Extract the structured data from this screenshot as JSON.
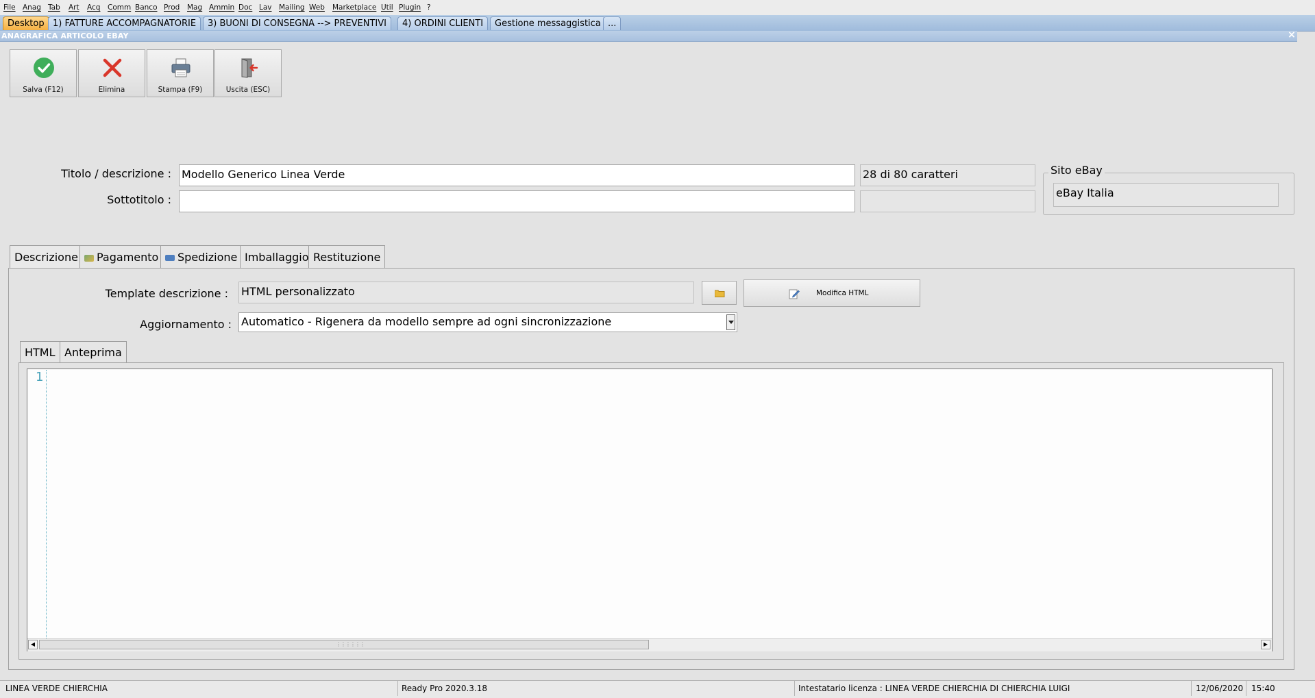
{
  "menu": [
    "File",
    "Anag",
    "Tab",
    "Art",
    "Acq",
    "Comm",
    "Banco",
    "Prod",
    "Mag",
    "Ammin",
    "Doc",
    "Lav",
    "Mailing",
    "Web",
    "Marketplace",
    "Util",
    "Plugin",
    "?"
  ],
  "doc_tabs": [
    "Desktop",
    "1) FATTURE ACCOMPAGNATORIE",
    "3) BUONI DI CONSEGNA --> PREVENTIVI",
    "4) ORDINI CLIENTI",
    "Gestione messaggistica",
    "..."
  ],
  "window": {
    "title": "ANAGRAFICA ARTICOLO EBAY",
    "close_glyph": "×"
  },
  "toolbar": {
    "save": "Salva (F12)",
    "delete": "Elimina",
    "print": "Stampa (F9)",
    "exit": "Uscita (ESC)"
  },
  "form": {
    "title_label": "Titolo / descrizione :",
    "title_value": "Modello Generico Linea Verde",
    "title_counter": "28 di 80 caratteri",
    "subtitle_label": "Sottotitolo :",
    "subtitle_value": "",
    "site_group_label": "Sito eBay",
    "site_value": "eBay Italia"
  },
  "main_tabs": [
    "Descrizione",
    "Pagamento",
    "Spedizione",
    "Imballaggio",
    "Restituzione"
  ],
  "description": {
    "template_label": "Template descrizione :",
    "template_value": "HTML personalizzato",
    "edit_html_label": "Modifica HTML",
    "update_label": "Aggiornamento :",
    "update_value": "Automatico - Rigenera da modello sempre ad ogni sincronizzazione"
  },
  "inner_tabs": [
    "HTML",
    "Anteprima"
  ],
  "editor": {
    "line_number": "1"
  },
  "status": {
    "company": "LINEA VERDE CHIERCHIA",
    "version": "Ready Pro 2020.3.18",
    "license": "Intestatario licenza : LINEA VERDE CHIERCHIA DI CHIERCHIA LUIGI",
    "date": "12/06/2020",
    "time": "15:40"
  },
  "colors": {
    "active_tab": "#f5b042",
    "accent_blue": "#9fbbdc",
    "save_green": "#3fae5a",
    "delete_red": "#d9362a"
  }
}
